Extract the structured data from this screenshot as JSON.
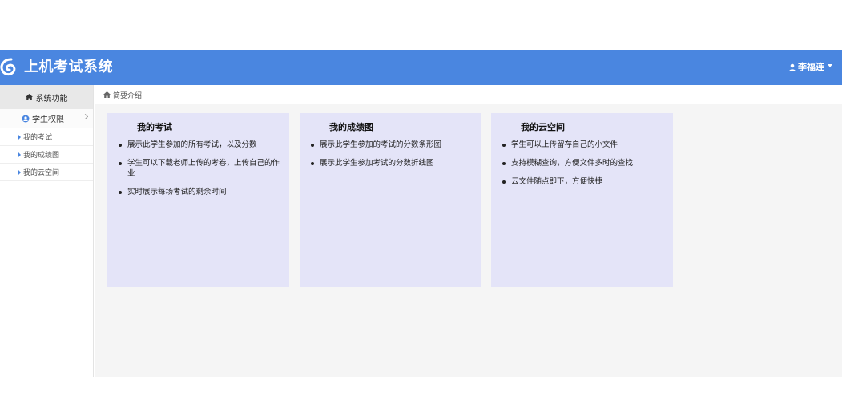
{
  "navbar": {
    "title": "上机考试系统",
    "user_name": "李福连",
    "brand_color": "#4a86e0",
    "logo_icon": "swirl-logo-icon",
    "user_icon": "user-icon"
  },
  "sidebar": {
    "header_label": "系统功能",
    "header_icon": "home-icon",
    "group_label": "学生权限",
    "group_icon": "user-circle-icon",
    "items": [
      {
        "label": "我的考试"
      },
      {
        "label": "我的成绩图"
      },
      {
        "label": "我的云空间"
      }
    ]
  },
  "breadcrumb": {
    "label": "简要介绍",
    "icon": "home-icon"
  },
  "cards": [
    {
      "title": "我的考试",
      "items": [
        "展示此学生参加的所有考试，以及分数",
        "学生可以下载老师上传的考卷，上传自己的作业",
        "实时展示每场考试的剩余时间"
      ]
    },
    {
      "title": "我的成绩图",
      "items": [
        "展示此学生参加的考试的分数条形图",
        "展示此学生参加考试的分数折线图"
      ]
    },
    {
      "title": "我的云空间",
      "items": [
        "学生可以上传留存自己的小文件",
        "支持模糊查询，方便文件多时的查找",
        "云文件随点即下，方便快捷"
      ]
    }
  ]
}
